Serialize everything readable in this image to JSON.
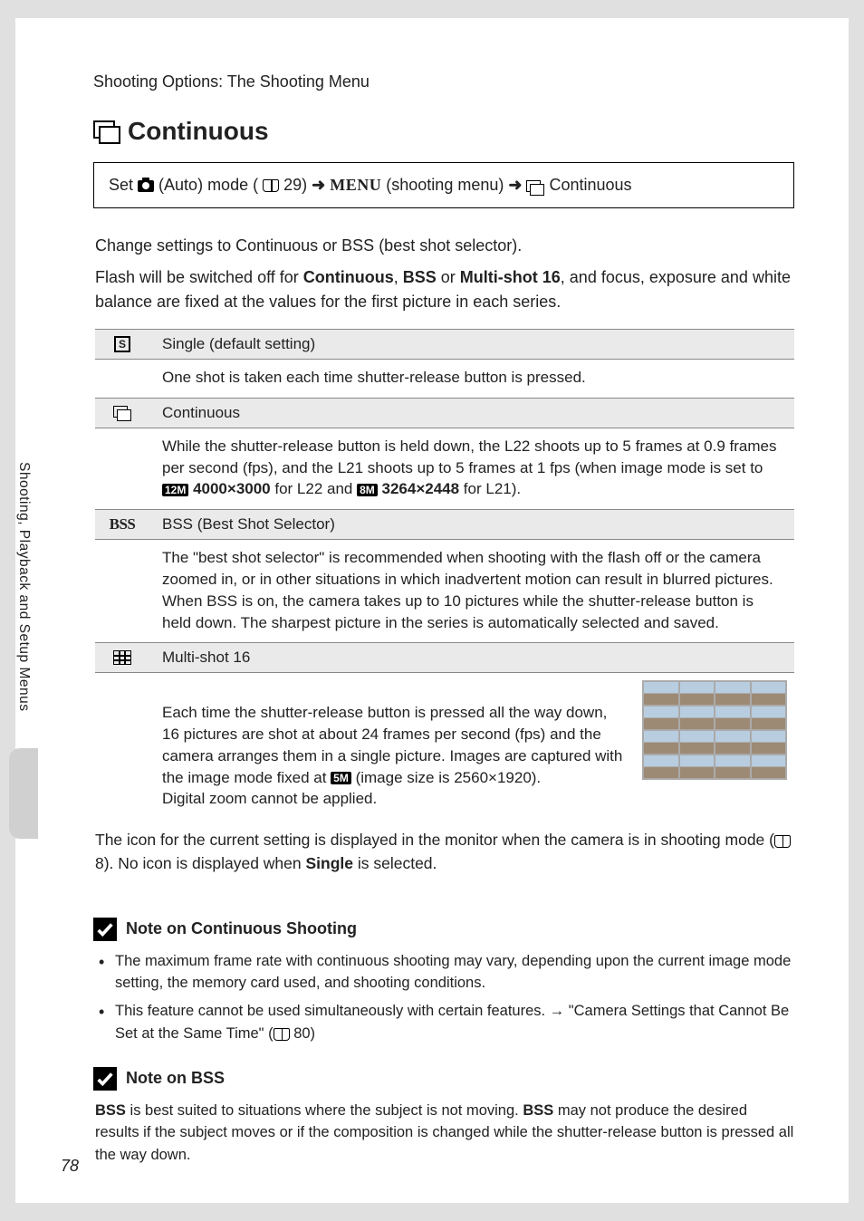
{
  "page_number": "78",
  "sidebar_text": "Shooting, Playback and Setup Menus",
  "section_header": "Shooting Options: The Shooting Menu",
  "title": "Continuous",
  "nav": {
    "pre": "Set ",
    "auto_mode": " (Auto) mode (",
    "ref1": " 29) ",
    "menu": "MENU",
    "shooting_menu": " (shooting menu) ",
    "continuous": " Continuous"
  },
  "intro1": "Change settings to Continuous or BSS (best shot selector).",
  "intro2_a": "Flash will be switched off for ",
  "intro2_cont": "Continuous",
  "intro2_b": ", ",
  "intro2_bss": "BSS",
  "intro2_c": " or ",
  "intro2_multi": "Multi-shot 16",
  "intro2_d": ", and focus, exposure and white balance are fixed at the values for the first picture in each series.",
  "options": {
    "single": {
      "label": "Single (default setting)",
      "body": "One shot is taken each time shutter-release button is pressed."
    },
    "continuous": {
      "label": "Continuous",
      "body_a": "While the shutter-release button is held down, the L22 shoots up to 5 frames at 0.9 frames per second (fps), and the L21 shoots up to 5 frames at 1 fps (when image mode is set to ",
      "mode12": "12M",
      "res1": " 4000×3000",
      "mid": " for L22 and ",
      "mode8": "8M",
      "res2": " 3264×2448",
      "end": " for L21)."
    },
    "bss": {
      "icon": "BSS",
      "label": "BSS (Best Shot Selector)",
      "body": "The \"best shot selector\" is recommended when shooting with the flash off or the camera zoomed in, or in other situations in which inadvertent motion can result in blurred pictures.\nWhen BSS is on, the camera takes up to 10 pictures while the shutter-release button is held down. The sharpest picture in the series is automatically selected and saved."
    },
    "multishot": {
      "label": "Multi-shot 16",
      "body_a": "Each time the shutter-release button is pressed all the way down, 16 pictures are shot at about 24 frames per second (fps) and the camera arranges them in a single picture. Images are captured with the image mode fixed at ",
      "mode5": "5M",
      "body_b": " (image size is 2560×1920).\nDigital zoom cannot be applied."
    }
  },
  "post_text_a": "The icon for the current setting is displayed in the monitor when the camera is in shooting mode (",
  "post_text_ref": " 8). No icon is displayed when ",
  "post_text_single": "Single",
  "post_text_b": " is selected.",
  "note1": {
    "heading": "Note on Continuous Shooting",
    "item1": "The maximum frame rate with continuous shooting may vary, depending upon the current image mode setting, the memory card used, and shooting conditions.",
    "item2_a": "This feature cannot be used simultaneously with certain features. → \"Camera Settings that Cannot Be Set at the Same Time\" (",
    "item2_ref": " 80)"
  },
  "note2": {
    "heading": "Note on BSS",
    "body_a": "BSS",
    "body_b": " is best suited to situations where the subject is not moving. ",
    "body_c": "BSS",
    "body_d": " may not produce the desired results if the subject moves or if the composition is changed while the shutter-release button is pressed all the way down."
  }
}
